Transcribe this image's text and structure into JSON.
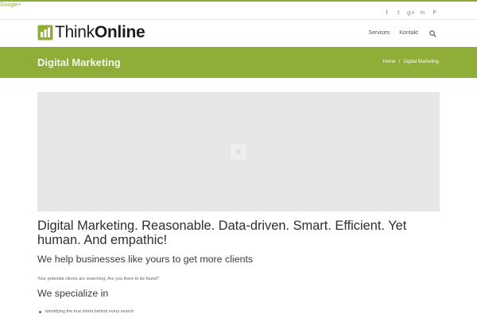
{
  "top_link": {
    "label": "Google+"
  },
  "social": {
    "icons": [
      {
        "name": "facebook-icon",
        "glyph": "f"
      },
      {
        "name": "twitter-icon",
        "glyph": "𝕥"
      },
      {
        "name": "google-plus-icon",
        "glyph": "g+"
      },
      {
        "name": "linkedin-icon",
        "glyph": "in"
      },
      {
        "name": "pinterest-icon",
        "glyph": "P"
      }
    ]
  },
  "header": {
    "logo_think": "Think",
    "logo_online": "Online",
    "nav": {
      "services_label": "Services",
      "contact_label": "Kontakt",
      "search_icon": "search-icon"
    }
  },
  "title_bar": {
    "title": "Digital Marketing",
    "breadcrumb": {
      "home": "Home",
      "separator": "/",
      "current": "Digital Marketing"
    }
  },
  "main": {
    "heading": "Digital Marketing. Reasonable. Data-driven. Smart. Efficient. Yet human. And empathic!",
    "subheading": "We help businesses like yours to get more clients",
    "intro": "Your potential clients are searching. Are you there to be found?",
    "specialize_heading": "We specialize in",
    "specialize_items": [
      "Identifying the true intent behind every search"
    ]
  },
  "colors": {
    "brand_green": "#8fae38",
    "accent_line": "#8bb02f",
    "video_placeholder": "#e6e6e6"
  }
}
